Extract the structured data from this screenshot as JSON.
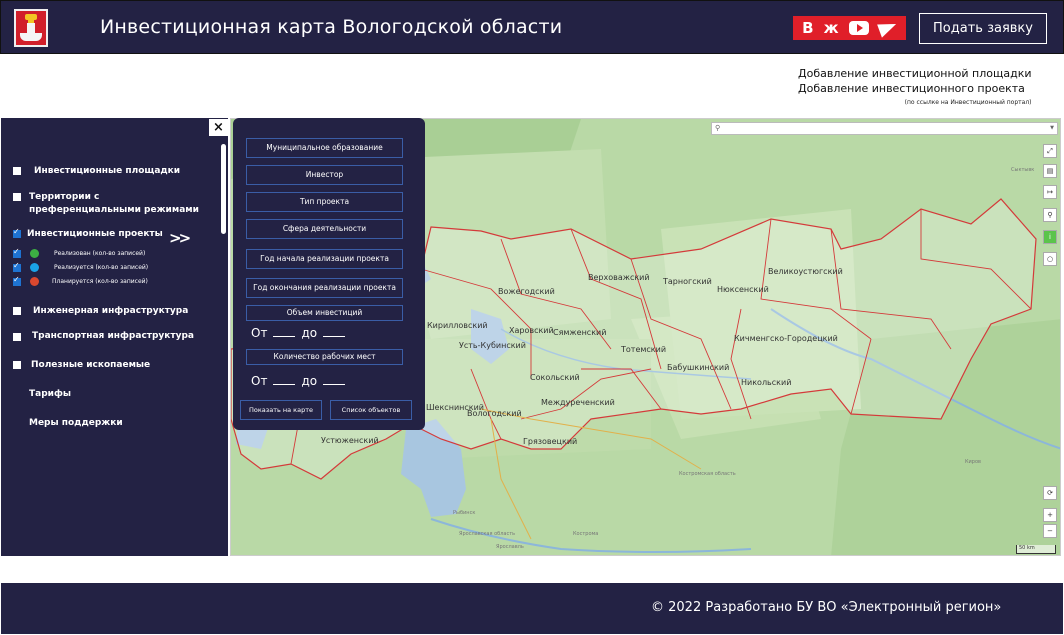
{
  "header": {
    "title": "Инвестиционная карта Вологодской области",
    "apply_label": "Подать заявку",
    "socials": [
      "vk-icon",
      "ok-icon",
      "youtube-icon",
      "telegram-icon"
    ],
    "brand_color": "#232244",
    "accent_color": "#e01f29"
  },
  "links": {
    "add_site": "Добавление инвестиционной площадки",
    "add_project": "Добавление инвестиционного проекта",
    "portal_note": "(по ссылке на Инвестиционный портал)"
  },
  "sidebar": {
    "layers": [
      {
        "label": "Инвестиционные площадки",
        "checked": false
      },
      {
        "label": "Территории с преференциальными режимами",
        "checked": false
      },
      {
        "label": "Инвестиционные проекты",
        "checked": true
      },
      {
        "label": "Инженерная инфраструктура",
        "checked": false
      },
      {
        "label": "Транспортная инфраструктура",
        "checked": false
      },
      {
        "label": "Полезные ископаемые",
        "checked": false
      },
      {
        "label": "Тарифы"
      },
      {
        "label": "Меры поддержки"
      }
    ],
    "project_statuses": [
      {
        "label": "Реализован (кол-во записей)",
        "color": "#3cb043",
        "checked": true
      },
      {
        "label": "Реализуется (кол-во записей)",
        "color": "#1aa3e8",
        "checked": true
      },
      {
        "label": "Планируется (кол-во записей)",
        "color": "#d9482f",
        "checked": true
      }
    ],
    "close_label": "×",
    "expand_label": ">>"
  },
  "filter": {
    "buttons": [
      "Муниципальное образование",
      "Инвестор",
      "Тип проекта",
      "Сфера деятельности",
      "Год начала реализации проекта",
      "Год окончания реализации проекта",
      "Объем инвестиций"
    ],
    "range_from": "От",
    "range_to": "до",
    "workers_label": "Количество рабочих мест",
    "show_on_map": "Показать на карте",
    "list_objects": "Список объектов"
  },
  "map": {
    "districts": [
      "Вожегодский",
      "Верховажский",
      "Тарногский",
      "Нюксенский",
      "Великоустюгский",
      "Харовский",
      "Сямженский",
      "Кирилловский",
      "Усть-Кубинский",
      "Тотемский",
      "Бабушкинский",
      "Кичменгско-Городецкий",
      "Никольский",
      "Сокольский",
      "Вологодский",
      "Междуреченский",
      "Шекснинский",
      "Грязовецкий",
      "Устюженский"
    ],
    "places": [
      "Сыктывк",
      "Киров",
      "Ярославль",
      "Кострома",
      "Рыбинск",
      "Костромская область",
      "Ярославская область"
    ],
    "controls": [
      "fullscreen-icon",
      "layers-icon",
      "ruler-icon",
      "locate-icon",
      "info-icon",
      "circle-icon"
    ],
    "zoom_in": "+",
    "zoom_out": "−",
    "refresh": "⟳",
    "scale": "50 km"
  },
  "footer": {
    "text": "© 2022 Разработано БУ ВО «Электронный регион»"
  }
}
